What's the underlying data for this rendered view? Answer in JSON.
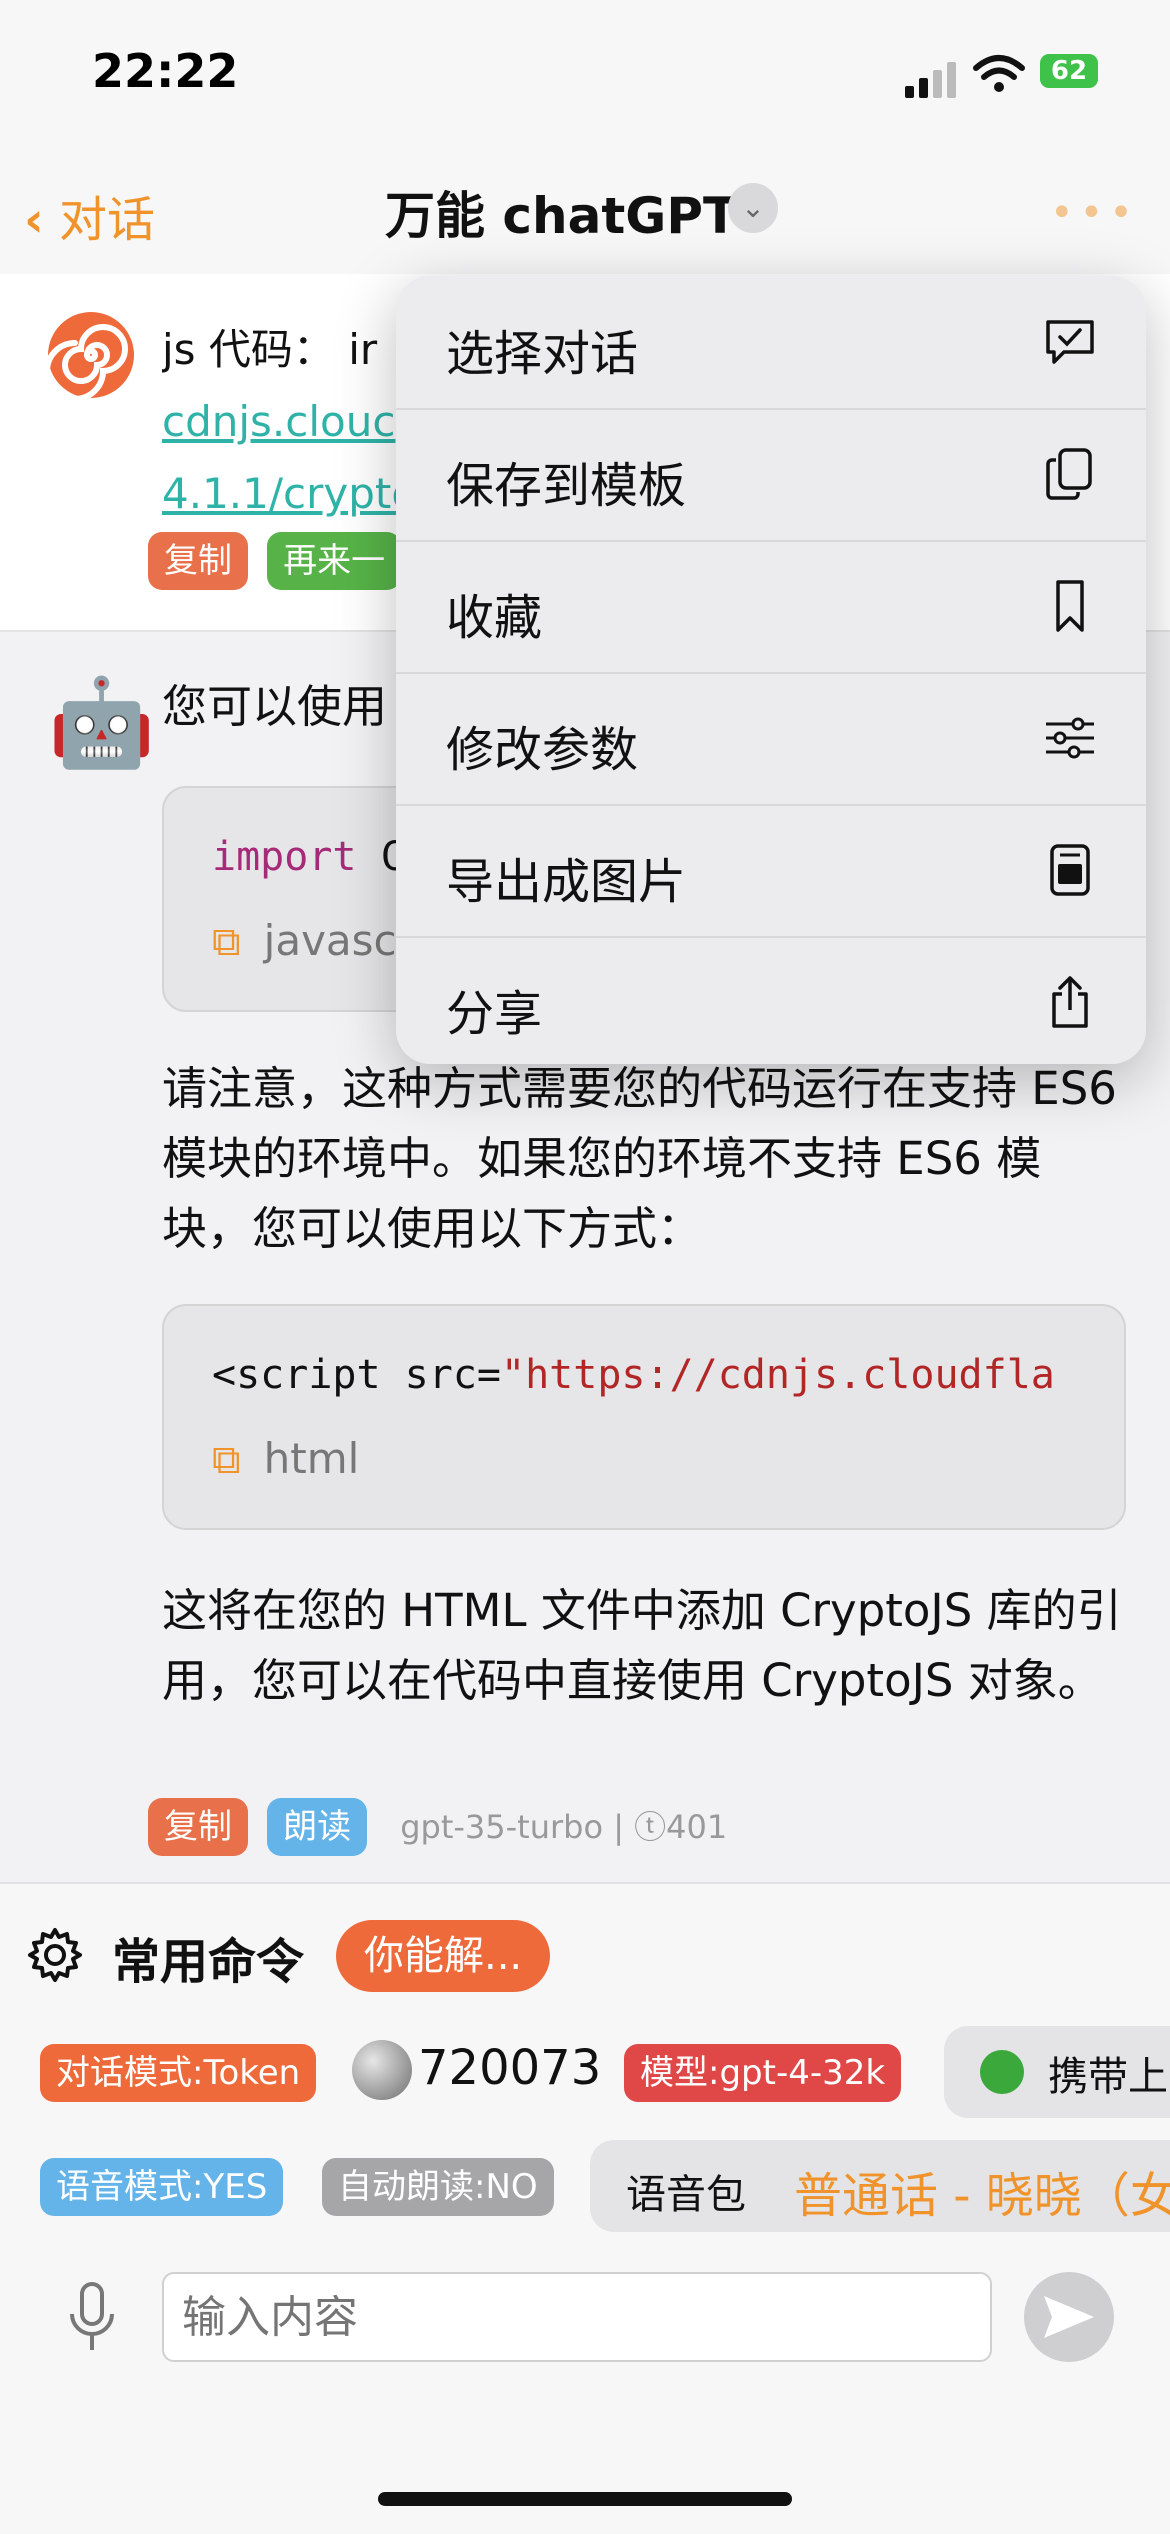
{
  "status": {
    "time": "22:22",
    "battery": "62"
  },
  "nav": {
    "back_label": "对话",
    "title": "万能 chatGPT"
  },
  "msg1": {
    "prefix": "js 代码： ir",
    "link_line1": "cdnjs.clouc",
    "link_line2": "4.1.1/crypto",
    "copy_label": "复制",
    "again_label": "再来一"
  },
  "msg2": {
    "intro": "您可以使用",
    "code1": {
      "keyword": "import",
      "rest": " C",
      "lang": "javasc"
    },
    "para1": "请注意，这种方式需要您的代码运行在支持 ES6 模块的环境中。如果您的环境不支持 ES6 模块，您可以使用以下方式：",
    "code2": {
      "tag": "<script src=",
      "str": "\"https://cdnjs.cloudfla",
      "lang": "html"
    },
    "para2": "这将在您的 HTML 文件中添加 CryptoJS 库的引用，您可以在代码中直接使用 CryptoJS 对象。",
    "copy_label": "复制",
    "read_label": "朗读",
    "meta": "gpt-35-turbo | ⓣ401"
  },
  "menu": {
    "items": [
      {
        "label": "选择对话",
        "icon": "chat-check-icon"
      },
      {
        "label": "保存到模板",
        "icon": "copy-docs-icon"
      },
      {
        "label": "收藏",
        "icon": "bookmark-icon"
      },
      {
        "label": "修改参数",
        "icon": "sliders-icon"
      },
      {
        "label": "导出成图片",
        "icon": "export-image-icon"
      },
      {
        "label": "分享",
        "icon": "share-icon"
      }
    ]
  },
  "panel": {
    "commands_label": "常用命令",
    "command_chip": "你能解...",
    "mode_token": "对话模式:Token",
    "coins": "720073",
    "model": "模型:gpt-4-32k",
    "carry": "携带上",
    "voice_mode": "语音模式:YES",
    "auto_read": "自动朗读:NO",
    "voice_pack_label": "语音包",
    "voice_pack_value": "普通话 - 晓晓（女",
    "input_placeholder": "输入内容"
  },
  "colors": {
    "accent": "#f0932b",
    "link": "#2fb3a8",
    "copy_tag": "#e8704a",
    "model_tag": "#e04848"
  }
}
